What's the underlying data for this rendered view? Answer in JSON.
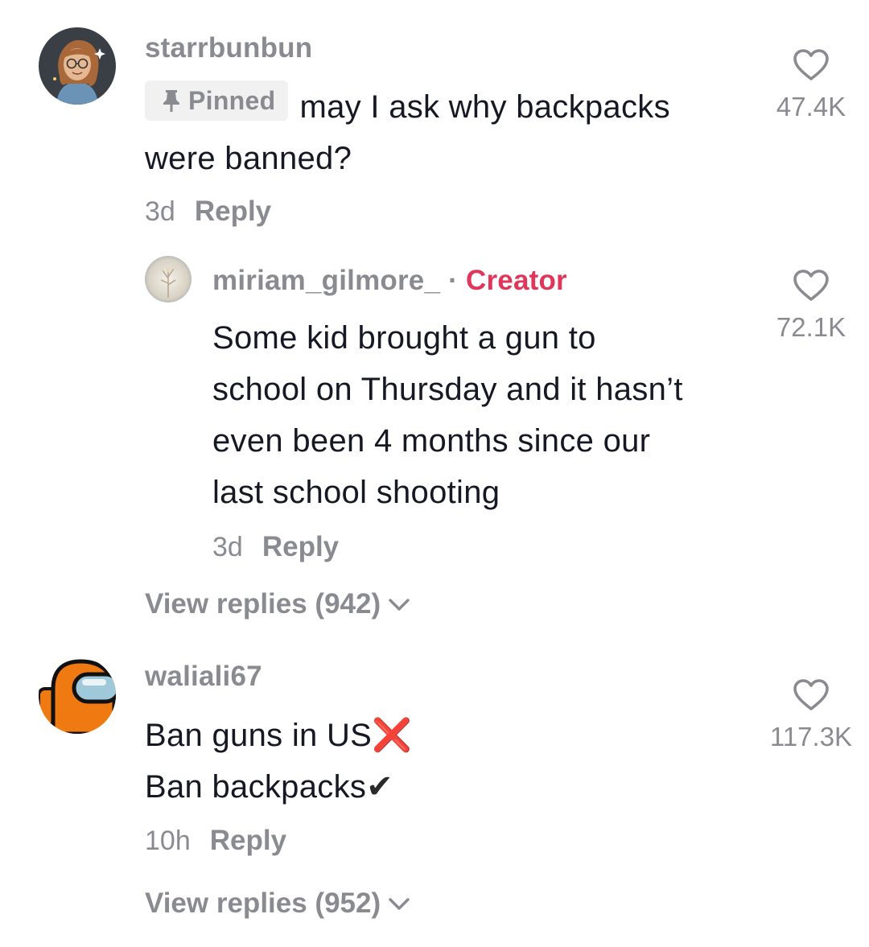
{
  "comments": [
    {
      "username": "starrbunbun",
      "pinned_label": "Pinned",
      "text_line1": "may I ask why backpacks",
      "text_line2": "were banned?",
      "time": "3d",
      "reply_label": "Reply",
      "likes": "47.4K",
      "reply": {
        "username": "miriam_gilmore_",
        "separator": "·",
        "badge": "Creator",
        "lines": [
          "Some kid brought a gun to",
          "school on Thursday and it hasn’t",
          "even been 4 months since our",
          "last school shooting"
        ],
        "time": "3d",
        "reply_label": "Reply",
        "likes": "72.1K"
      },
      "view_replies": "View replies (942)"
    },
    {
      "username": "waliali67",
      "line1": "Ban guns in US",
      "line1_emoji": "❌",
      "line2": "Ban backpacks",
      "line2_emoji": "✔",
      "time": "10h",
      "reply_label": "Reply",
      "likes": "117.3K",
      "view_replies": "View replies (952)"
    }
  ],
  "colors": {
    "text": "#161823",
    "muted": "#8a8b91",
    "creator": "#e0365a",
    "badge_bg": "#f1f1f2"
  }
}
